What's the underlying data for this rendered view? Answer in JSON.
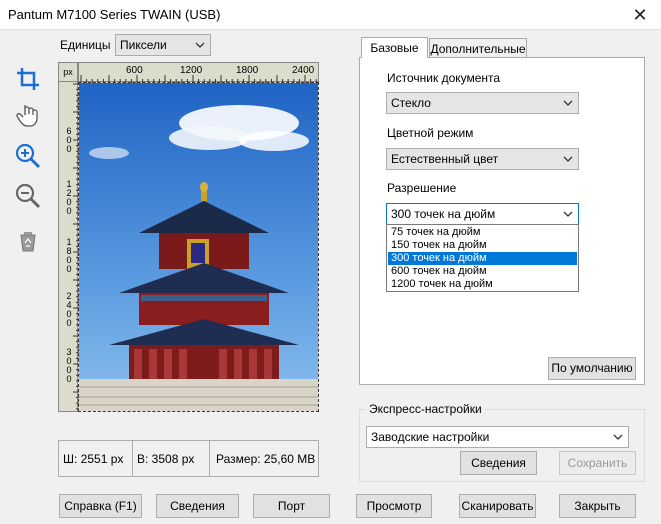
{
  "window": {
    "title": "Pantum M7100 Series TWAIN (USB)"
  },
  "units": {
    "label": "Единицы",
    "value": "Пиксели"
  },
  "ruler": {
    "corner": "px",
    "top_ticks": [
      "600",
      "1200",
      "1800",
      "2400"
    ],
    "left_ticks": [
      "600",
      "1200",
      "1800",
      "2400",
      "3000"
    ]
  },
  "info": {
    "width": "Ш: 2551 px",
    "height": "В: 3508 px",
    "size": "Размер: 25,60 MB"
  },
  "tabs": {
    "basic": "Базовые",
    "advanced": "Дополнительные"
  },
  "source": {
    "label": "Источник документа",
    "value": "Стекло"
  },
  "color": {
    "label": "Цветной режим",
    "value": "Естественный цвет"
  },
  "resolution": {
    "label": "Разрешение",
    "value": "300 точек на дюйм",
    "options": [
      "75 точек на дюйм",
      "150 точек на дюйм",
      "300 точек на дюйм",
      "600 точек на дюйм",
      "1200 точек на дюйм"
    ],
    "selected_index": 2
  },
  "defaults_button": "По умолчанию",
  "express": {
    "title": "Экспресс-настройки",
    "value": "Заводские настройки",
    "info_button": "Сведения",
    "save_button": "Сохранить"
  },
  "buttons": {
    "help": "Справка (F1)",
    "info": "Сведения",
    "port": "Порт",
    "preview": "Просмотр",
    "scan": "Сканировать",
    "close": "Закрыть"
  },
  "colors": {
    "accent": "#0078d7",
    "sky_top": "#1f63c4",
    "sky_bottom": "#8ec0ee",
    "tool_blue": "#1a6fd8"
  }
}
